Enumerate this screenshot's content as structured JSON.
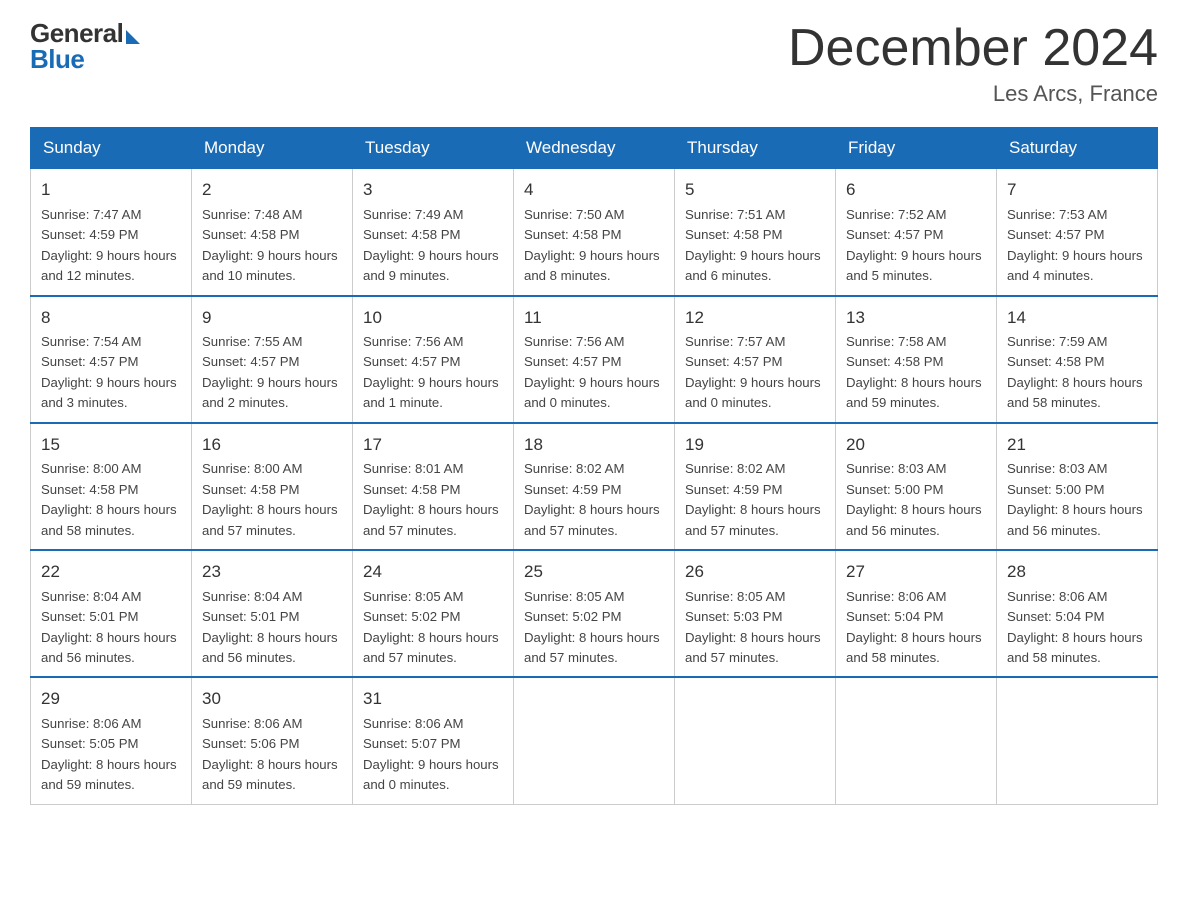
{
  "header": {
    "title": "December 2024",
    "location": "Les Arcs, France",
    "logo_general": "General",
    "logo_blue": "Blue"
  },
  "days_of_week": [
    "Sunday",
    "Monday",
    "Tuesday",
    "Wednesday",
    "Thursday",
    "Friday",
    "Saturday"
  ],
  "weeks": [
    [
      {
        "day": "1",
        "sunrise": "7:47 AM",
        "sunset": "4:59 PM",
        "daylight": "9 hours and 12 minutes."
      },
      {
        "day": "2",
        "sunrise": "7:48 AM",
        "sunset": "4:58 PM",
        "daylight": "9 hours and 10 minutes."
      },
      {
        "day": "3",
        "sunrise": "7:49 AM",
        "sunset": "4:58 PM",
        "daylight": "9 hours and 9 minutes."
      },
      {
        "day": "4",
        "sunrise": "7:50 AM",
        "sunset": "4:58 PM",
        "daylight": "9 hours and 8 minutes."
      },
      {
        "day": "5",
        "sunrise": "7:51 AM",
        "sunset": "4:58 PM",
        "daylight": "9 hours and 6 minutes."
      },
      {
        "day": "6",
        "sunrise": "7:52 AM",
        "sunset": "4:57 PM",
        "daylight": "9 hours and 5 minutes."
      },
      {
        "day": "7",
        "sunrise": "7:53 AM",
        "sunset": "4:57 PM",
        "daylight": "9 hours and 4 minutes."
      }
    ],
    [
      {
        "day": "8",
        "sunrise": "7:54 AM",
        "sunset": "4:57 PM",
        "daylight": "9 hours and 3 minutes."
      },
      {
        "day": "9",
        "sunrise": "7:55 AM",
        "sunset": "4:57 PM",
        "daylight": "9 hours and 2 minutes."
      },
      {
        "day": "10",
        "sunrise": "7:56 AM",
        "sunset": "4:57 PM",
        "daylight": "9 hours and 1 minute."
      },
      {
        "day": "11",
        "sunrise": "7:56 AM",
        "sunset": "4:57 PM",
        "daylight": "9 hours and 0 minutes."
      },
      {
        "day": "12",
        "sunrise": "7:57 AM",
        "sunset": "4:57 PM",
        "daylight": "9 hours and 0 minutes."
      },
      {
        "day": "13",
        "sunrise": "7:58 AM",
        "sunset": "4:58 PM",
        "daylight": "8 hours and 59 minutes."
      },
      {
        "day": "14",
        "sunrise": "7:59 AM",
        "sunset": "4:58 PM",
        "daylight": "8 hours and 58 minutes."
      }
    ],
    [
      {
        "day": "15",
        "sunrise": "8:00 AM",
        "sunset": "4:58 PM",
        "daylight": "8 hours and 58 minutes."
      },
      {
        "day": "16",
        "sunrise": "8:00 AM",
        "sunset": "4:58 PM",
        "daylight": "8 hours and 57 minutes."
      },
      {
        "day": "17",
        "sunrise": "8:01 AM",
        "sunset": "4:58 PM",
        "daylight": "8 hours and 57 minutes."
      },
      {
        "day": "18",
        "sunrise": "8:02 AM",
        "sunset": "4:59 PM",
        "daylight": "8 hours and 57 minutes."
      },
      {
        "day": "19",
        "sunrise": "8:02 AM",
        "sunset": "4:59 PM",
        "daylight": "8 hours and 57 minutes."
      },
      {
        "day": "20",
        "sunrise": "8:03 AM",
        "sunset": "5:00 PM",
        "daylight": "8 hours and 56 minutes."
      },
      {
        "day": "21",
        "sunrise": "8:03 AM",
        "sunset": "5:00 PM",
        "daylight": "8 hours and 56 minutes."
      }
    ],
    [
      {
        "day": "22",
        "sunrise": "8:04 AM",
        "sunset": "5:01 PM",
        "daylight": "8 hours and 56 minutes."
      },
      {
        "day": "23",
        "sunrise": "8:04 AM",
        "sunset": "5:01 PM",
        "daylight": "8 hours and 56 minutes."
      },
      {
        "day": "24",
        "sunrise": "8:05 AM",
        "sunset": "5:02 PM",
        "daylight": "8 hours and 57 minutes."
      },
      {
        "day": "25",
        "sunrise": "8:05 AM",
        "sunset": "5:02 PM",
        "daylight": "8 hours and 57 minutes."
      },
      {
        "day": "26",
        "sunrise": "8:05 AM",
        "sunset": "5:03 PM",
        "daylight": "8 hours and 57 minutes."
      },
      {
        "day": "27",
        "sunrise": "8:06 AM",
        "sunset": "5:04 PM",
        "daylight": "8 hours and 58 minutes."
      },
      {
        "day": "28",
        "sunrise": "8:06 AM",
        "sunset": "5:04 PM",
        "daylight": "8 hours and 58 minutes."
      }
    ],
    [
      {
        "day": "29",
        "sunrise": "8:06 AM",
        "sunset": "5:05 PM",
        "daylight": "8 hours and 59 minutes."
      },
      {
        "day": "30",
        "sunrise": "8:06 AM",
        "sunset": "5:06 PM",
        "daylight": "8 hours and 59 minutes."
      },
      {
        "day": "31",
        "sunrise": "8:06 AM",
        "sunset": "5:07 PM",
        "daylight": "9 hours and 0 minutes."
      },
      null,
      null,
      null,
      null
    ]
  ],
  "labels": {
    "sunrise": "Sunrise:",
    "sunset": "Sunset:",
    "daylight": "Daylight:"
  }
}
